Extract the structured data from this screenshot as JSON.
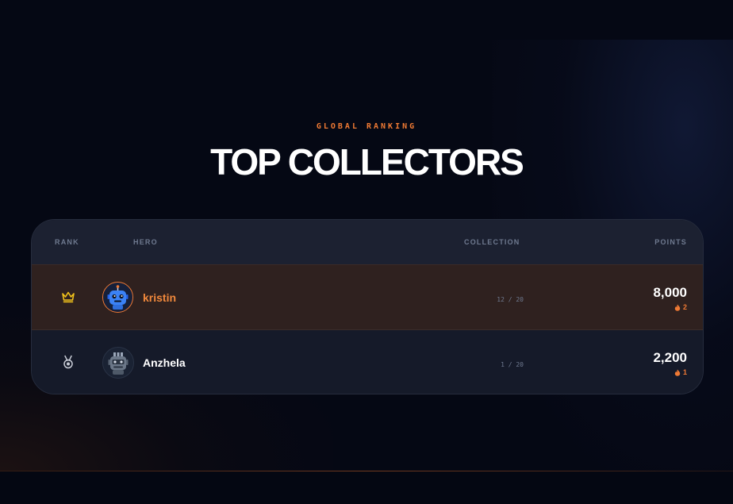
{
  "header": {
    "eyebrow": "GLOBAL RANKING",
    "title": "TOP COLLECTORS"
  },
  "table": {
    "columns": {
      "rank": "RANK",
      "hero": "HERO",
      "collection": "COLLECTION",
      "points": "POINTS"
    },
    "rows": [
      {
        "rank_icon": "crown-icon",
        "avatar": "blue-robot-avatar",
        "name": "kristin",
        "collection": "12 / 20",
        "points": "8,000",
        "streak": "2"
      },
      {
        "rank_icon": "medal-icon",
        "avatar": "gray-robot-avatar",
        "name": "Anzhela",
        "collection": "1 / 20",
        "points": "2,200",
        "streak": "1"
      }
    ]
  },
  "colors": {
    "accent": "#f07a34",
    "background": "#050814",
    "highlight_row": "#2f211f",
    "crown": "#f2c21b"
  }
}
